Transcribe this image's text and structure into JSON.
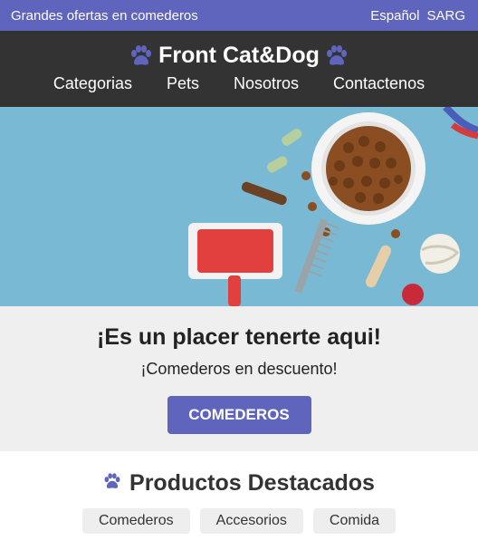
{
  "topbar": {
    "promo_text": "Grandes ofertas en comederos",
    "language": "Español",
    "currency": "SARG"
  },
  "header": {
    "brand": "Front Cat&Dog",
    "nav": [
      "Categorias",
      "Pets",
      "Nosotros",
      "Contactenos"
    ]
  },
  "promo": {
    "title": "¡Es un placer tenerte aqui!",
    "subtitle": "¡Comederos en descuento!",
    "cta": "COMEDEROS"
  },
  "featured": {
    "title": "Productos Destacados",
    "tags": [
      "Comederos",
      "Accesorios",
      "Comida"
    ]
  },
  "colors": {
    "accent": "#5f64bd",
    "header_bg": "#333333",
    "hero_bg": "#7ab9d4",
    "promo_bg": "#efefef"
  }
}
